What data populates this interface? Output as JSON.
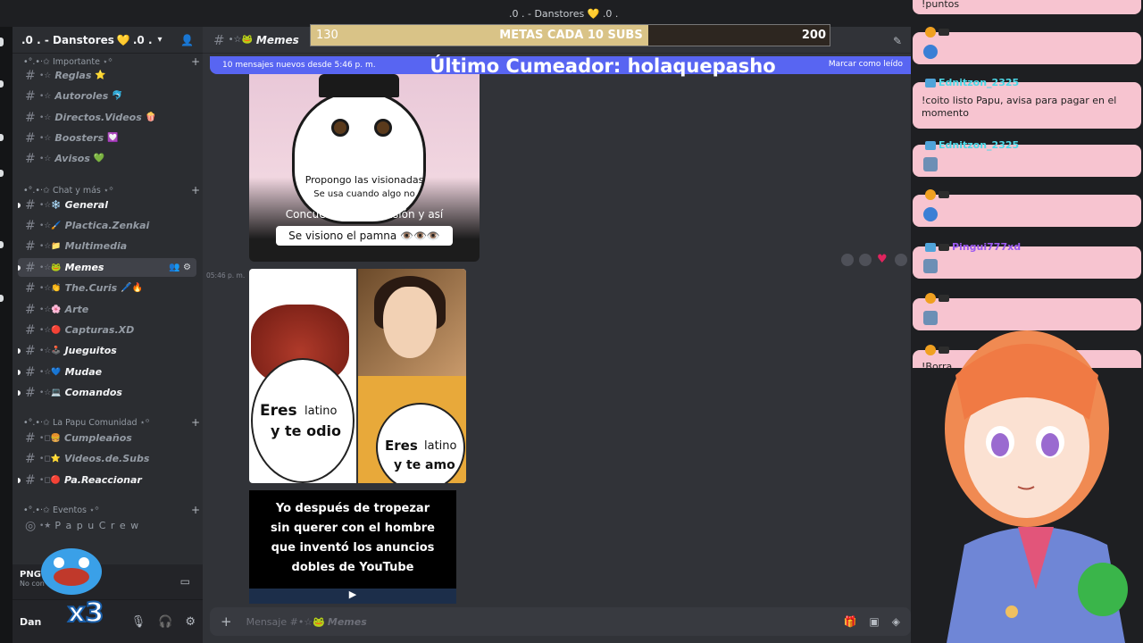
{
  "window": {
    "title": ".0 . - Danstores 💛 .0 ."
  },
  "server": {
    "name": ".0 . - Danstores",
    "suffix": ".0 ."
  },
  "sidebar": {
    "categories": [
      {
        "label": "•°.•‧✩ Importante ⋆꙳"
      },
      {
        "label": "•°.•‧✩ Chat y más ⋆꙳"
      },
      {
        "label": "•°.•‧✩ La Papu Comunidad ⋆꙳"
      },
      {
        "label": "•°.•‧✩ Eventos ⋆꙳"
      }
    ],
    "channels": [
      {
        "deco": "•☆",
        "name": "Reglas",
        "emoji": "⭐"
      },
      {
        "deco": "•☆",
        "name": "Autoroles",
        "emoji": "🐬"
      },
      {
        "deco": "•☆",
        "name": "Directos.Videos",
        "emoji": "🍿"
      },
      {
        "deco": "•☆",
        "name": "Boosters",
        "emoji": "💟"
      },
      {
        "deco": "•☆",
        "name": "Avisos",
        "emoji": "💚"
      },
      {
        "deco": "•☆❄️",
        "name": "General",
        "emoji": ""
      },
      {
        "deco": "•☆🖌️",
        "name": "Plactica.Zenkai",
        "emoji": ""
      },
      {
        "deco": "•☆📁",
        "name": "Multimedia",
        "emoji": ""
      },
      {
        "deco": "•☆🐸",
        "name": "Memes",
        "emoji": ""
      },
      {
        "deco": "•☆👏",
        "name": "The.Curis",
        "emoji": "🖊️🔥"
      },
      {
        "deco": "•☆🌸",
        "name": "Arte",
        "emoji": ""
      },
      {
        "deco": "•☆🔴",
        "name": "Capturas.XD",
        "emoji": ""
      },
      {
        "deco": "•☆🕹️",
        "name": "Jueguitos",
        "emoji": ""
      },
      {
        "deco": "•☆💙",
        "name": "Mudae",
        "emoji": ""
      },
      {
        "deco": "•☆💻",
        "name": "Comandos",
        "emoji": ""
      },
      {
        "deco": "•◻🍔",
        "name": "Cumpleaños",
        "emoji": ""
      },
      {
        "deco": "•◻⭐",
        "name": "Videos.de.Subs",
        "emoji": ""
      },
      {
        "deco": "•◻🔴",
        "name": "Pa.Reaccionar",
        "emoji": ""
      },
      {
        "deco": "•★",
        "name": "P a p u C r e w",
        "emoji": ""
      }
    ],
    "voice": {
      "title": "PNGTub",
      "subtitle": "No con"
    },
    "user": {
      "name": "Dan"
    },
    "png_label": "x3"
  },
  "channel_header": {
    "prefix": "•☆🐸",
    "title": "Memes"
  },
  "new_messages": {
    "text": "10 mensajes nuevos desde 5:46 p. m.",
    "mark": "Marcar como leído"
  },
  "goal": {
    "min": "130",
    "label": "METAS CADA 10 SUBS",
    "max": "200",
    "progress": 0.65
  },
  "cumeador": "Último Cumeador: holaquepasho",
  "messages": {
    "meme1": {
      "line1": "Propongo las visionadas",
      "line2": "Se usa cuando algo no",
      "line3": "Concuerda con tu visión y así",
      "line4": "Se visiono el pamna 👁️👁️👁️"
    },
    "timestamp": "05:46 p. m.",
    "meme2": {
      "left_word": "Eres",
      "left_rest": "latino",
      "left_line2": "y te odio",
      "right_word": "Eres",
      "right_rest": "latino",
      "right_line2": "y te amo"
    },
    "meme3": {
      "line1": "Yo después de tropezar",
      "line2": "sin querer con el hombre",
      "line3": "que inventó los anuncios",
      "line4": "dobles de YouTube"
    }
  },
  "composer": {
    "placeholder_prefix": "Mensaje #•☆🐸",
    "placeholder_channel": "Memes"
  },
  "stream_chat": [
    {
      "name": "",
      "text": "!puntos"
    },
    {
      "name": "",
      "text": ""
    },
    {
      "name": "Ednitzon_2325",
      "text": "!coito listo Papu, avisa para pagar en el momento"
    },
    {
      "name": "Ednitzon_2325",
      "text": ""
    },
    {
      "name": "",
      "text": ""
    },
    {
      "name": "Pingui777xd",
      "text": ""
    },
    {
      "name": "",
      "text": ""
    },
    {
      "name": "",
      "text": "!Borra"
    }
  ],
  "colors": {
    "accent": "#5865f2",
    "goal_fill": "#d9c387",
    "chat_bubble": "#f7c4d0"
  }
}
